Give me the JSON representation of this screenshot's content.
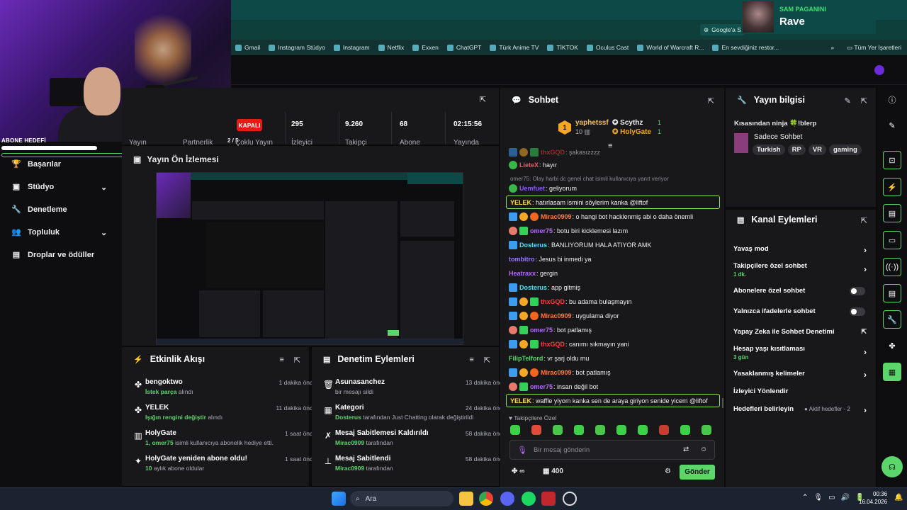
{
  "now_playing": {
    "artist": "SAM PAGANINI",
    "song": "Rave"
  },
  "browser": {
    "google_chip": "Google'a S",
    "bookmarks": [
      "Gmail",
      "Instagram Stüdyo",
      "Instagram",
      "Netflix",
      "Exxen",
      "ChatGPT",
      "Türk Anime TV",
      "TİKTOK",
      "Oculus Cast",
      "World of Warcraft R...",
      "En sevdiğiniz restor..."
    ],
    "bookmarks_more": "»",
    "all_bookmarks": "Tüm Yer İşaretleri"
  },
  "overlay": {
    "label": "ABONE HEDEFİ"
  },
  "nav": {
    "items": [
      {
        "label": "Başarılar",
        "icon": "trophy-icon",
        "glyph": "🏆"
      },
      {
        "label": "Stüdyo",
        "icon": "studio-icon",
        "glyph": "▣",
        "chevron": "⌄"
      },
      {
        "label": "Denetleme",
        "icon": "wrench-icon",
        "glyph": "🔧"
      },
      {
        "label": "Topluluk",
        "icon": "community-icon",
        "glyph": "👥",
        "chevron": "⌄"
      },
      {
        "label": "Droplar ve ödüller",
        "icon": "drops-icon",
        "glyph": "▤"
      }
    ]
  },
  "stats": {
    "status": "KAPALI",
    "left_labels": [
      "Yayın",
      "Partnerlik"
    ],
    "partner_fraction": "2 / 5",
    "multi": "Çoklu Yayın",
    "items": [
      {
        "value": "295",
        "label": "İzleyici"
      },
      {
        "value": "9.260",
        "label": "Takipçi"
      },
      {
        "value": "68",
        "label": "Abone"
      },
      {
        "value": "02:15:56",
        "label": "Yayında"
      }
    ]
  },
  "preview": {
    "title": "Yayın Ön İzlemesi"
  },
  "activity": {
    "title": "Etkinlik Akışı",
    "events": [
      {
        "icon": "bits-icon",
        "glyph": "✤",
        "name": "bengoktwo",
        "detail_pre": "",
        "detail_b": "İstek parça",
        "detail_post": " alındı",
        "time": "1 dakika önce"
      },
      {
        "icon": "bits-icon",
        "glyph": "✤",
        "name": "YELEK",
        "detail_pre": "",
        "detail_b": "Işığın rengini değiştir",
        "detail_post": " alındı",
        "time": "11 dakika önce"
      },
      {
        "icon": "gift-icon",
        "glyph": "▥",
        "name": "HolyGate",
        "detail_pre": "",
        "detail_b": "1, omer75",
        "detail_post": " isimli kullanıcıya abonelik hediye etti.",
        "time": "1 saat önce"
      },
      {
        "icon": "sparkle-icon",
        "glyph": "✦",
        "name": "HolyGate yeniden abone oldu!",
        "detail_pre": "",
        "detail_b": "10",
        "detail_post": " aylık abone oldular",
        "time": "1 saat önce"
      }
    ]
  },
  "mod_actions": {
    "title": "Denetim Eylemleri",
    "events": [
      {
        "icon": "trash-icon",
        "glyph": "🗑",
        "name": "Asunasanchez",
        "detail_pre": "bir mesajı sildi",
        "detail_b": "",
        "detail_post": "",
        "time": "13 dakika önce"
      },
      {
        "icon": "category-icon",
        "glyph": "▦",
        "name": "Kategori",
        "detail_pre": "",
        "detail_b": "Dosterus",
        "detail_post": " tarafından Just Chatting olarak değiştirildi",
        "time": "24 dakika önce"
      },
      {
        "icon": "unpin-icon",
        "glyph": "✗",
        "name": "Mesaj Sabitlemesi Kaldırıldı",
        "detail_pre": "",
        "detail_b": "Mirac0909",
        "detail_post": " tarafından",
        "time": "58 dakika önce"
      },
      {
        "icon": "pin-icon",
        "glyph": "⊥",
        "name": "Mesaj Sabitlendi",
        "detail_pre": "",
        "detail_b": "Mirac0909",
        "detail_post": " tarafından",
        "time": "58 dakika önce"
      }
    ]
  },
  "chat": {
    "title": "Sohbet",
    "gifter": {
      "name": "yaphetssf",
      "count": "10",
      "rank": "1"
    },
    "leaders": [
      {
        "name": "Scythz",
        "count": "1"
      },
      {
        "name": "HolyGate",
        "count": "1"
      }
    ],
    "reply_context": "omer75: Olay harbi dc genel chat isimli kullanıcıya yanıt veriyor",
    "messages": [
      {
        "user": "thxGQD",
        "color": "#ff3c3c",
        "text": ": şakasızzzz",
        "badges": [
          "b-blue",
          "b-gold",
          "b-green"
        ],
        "dim": true
      },
      {
        "user": "LieteX",
        "color": "#ff4f6a",
        "text": ": hayır",
        "badges": [
          "b-clover"
        ]
      },
      {
        "user": "Uemfuet",
        "color": "#8a5cf6",
        "text": ": geliyorum",
        "badges": [
          "b-clover"
        ]
      },
      {
        "user": "YELEK",
        "color": "#ffd84a",
        "text": ": hatırlasam ismini söylerim kanka @liftof",
        "badges": [],
        "highlight": true
      },
      {
        "user": "Mirac0909",
        "color": "#ff7a3c",
        "text": ": o hangi bot hacklenmiş abi o daha önemli",
        "badges": [
          "b-blue",
          "b-gold",
          "b-orange"
        ]
      },
      {
        "user": "omer75",
        "color": "#b46cf2",
        "text": ": botu biri kicklemesi lazım",
        "badges": [
          "b-flower",
          "b-green"
        ]
      },
      {
        "user": "Dosterus",
        "color": "#5ad9f5",
        "text": ": BANLIYORUM HALA ATIYOR AMK",
        "badges": [
          "b-blue"
        ]
      },
      {
        "user": "tombitro",
        "color": "#9b7cf5",
        "text": ": Jesus bi inmedi ya",
        "badges": []
      },
      {
        "user": "Heatraxx",
        "color": "#b46cf2",
        "text": ": gergin",
        "badges": []
      },
      {
        "user": "Dosterus",
        "color": "#5ad9f5",
        "text": ": app gitmiş",
        "badges": [
          "b-blue"
        ]
      },
      {
        "user": "thxGQD",
        "color": "#ff3c3c",
        "text": ": bu adama bulaşmayın",
        "badges": [
          "b-blue",
          "b-gold",
          "b-green"
        ]
      },
      {
        "user": "Mirac0909",
        "color": "#ff7a3c",
        "text": ": uygulama diyor",
        "badges": [
          "b-blue",
          "b-gold",
          "b-orange"
        ]
      },
      {
        "user": "omer75",
        "color": "#b46cf2",
        "text": ": bot patlamış",
        "badges": [
          "b-flower",
          "b-green"
        ]
      },
      {
        "user": "thxGQD",
        "color": "#ff3c3c",
        "text": ": canımı sıkmayın yani",
        "badges": [
          "b-blue",
          "b-gold",
          "b-green"
        ]
      },
      {
        "user": "FilipTelford",
        "color": "#5bd66a",
        "text": ": vr şarj oldu mu",
        "badges": []
      },
      {
        "user": "Mirac0909",
        "color": "#ff7a3c",
        "text": ": bot patlamış",
        "badges": [
          "b-blue",
          "b-gold",
          "b-orange"
        ]
      },
      {
        "user": "omer75",
        "color": "#b46cf2",
        "text": ": insan değil bot",
        "badges": [
          "b-flower",
          "b-green"
        ]
      },
      {
        "user": "YELEK",
        "color": "#ffd84a",
        "text": ": waffle yiyom kanka sen de araya giriyon senide yicem @liftof",
        "badges": [],
        "highlight": true
      }
    ],
    "followers_only": "Takipçilere Özel",
    "input_placeholder": "Bir mesaj gönderin",
    "points": "400",
    "send": "Gönder"
  },
  "stream_info": {
    "title": "Yayın bilgisi",
    "stream_title": "Kısasından ninja 🍀!blerp",
    "category": "Sadece Sohbet",
    "tags": [
      "Turkish",
      "RP",
      "VR",
      "gaming"
    ]
  },
  "channel_actions": {
    "title": "Kanal Eylemleri",
    "rows": [
      {
        "label": "Yavaş mod",
        "sub": "",
        "control": "chevron"
      },
      {
        "label": "Takipçilere özel sohbet",
        "sub": "1 dk.",
        "control": "chevron"
      },
      {
        "label": "Abonelere özel sohbet",
        "sub": "",
        "control": "toggle"
      },
      {
        "label": "Yalnızca ifadelerle sohbet",
        "sub": "",
        "control": "toggle"
      },
      {
        "label": "Yapay Zeka ile Sohbet Denetimi",
        "sub": "",
        "control": "external"
      },
      {
        "label": "Hesap yaşı kısıtlaması",
        "sub": "3 gün",
        "control": "chevron"
      },
      {
        "label": "Yasaklanmış kelimeler",
        "sub": "",
        "control": "chevron"
      },
      {
        "label": "İzleyici Yönlendir",
        "sub": "",
        "control": "none"
      },
      {
        "label": "Hedefleri belirleyin",
        "sub": "",
        "control": "chevron",
        "side": "● Aktif hedefler - 2"
      }
    ]
  },
  "taskbar": {
    "search": "Ara",
    "time": "00:36",
    "date": "16.04.2026"
  },
  "colors": {
    "accent": "#5bd66a",
    "panel": "#18181b",
    "live_red": "#e91916"
  }
}
